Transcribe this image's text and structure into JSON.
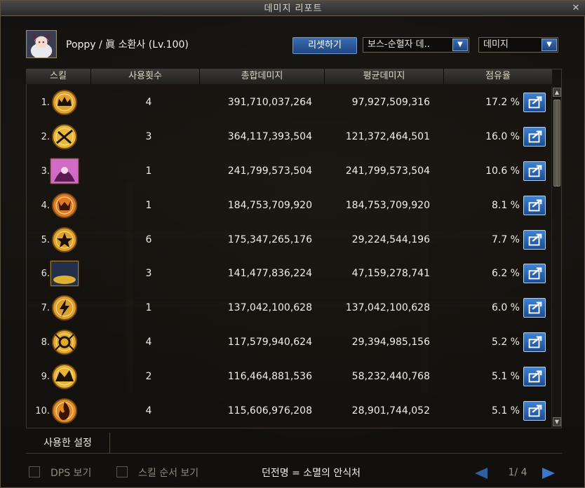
{
  "window": {
    "title": "데미지 리포트",
    "close_glyph": "✕"
  },
  "character": {
    "info": "Poppy / 眞 소환사 (Lv.100)"
  },
  "toolbar": {
    "reset_label": "리셋하기",
    "boss_dropdown": "보스-순혈자 데..",
    "type_dropdown": "데미지"
  },
  "table": {
    "headers": {
      "skill": "스킬",
      "count": "사용횟수",
      "total": "총합데미지",
      "avg": "평균데미지",
      "share": "점유율"
    },
    "rows": [
      {
        "rank": "1.",
        "count": "4",
        "total": "391,710,037,264",
        "avg": "97,927,509,316",
        "share": "17.2 %",
        "icon": "crown-sigil-icon",
        "color": "#e3a22c"
      },
      {
        "rank": "2.",
        "count": "3",
        "total": "364,117,393,504",
        "avg": "121,372,464,501",
        "share": "16.0 %",
        "icon": "slash-sigil-icon",
        "color": "#e7b83a"
      },
      {
        "rank": "3.",
        "count": "1",
        "total": "241,799,573,504",
        "avg": "241,799,573,504",
        "share": "10.6 %",
        "icon": "pink-summon-icon",
        "color": "#d06bc6"
      },
      {
        "rank": "4.",
        "count": "1",
        "total": "184,753,709,920",
        "avg": "184,753,709,920",
        "share": "8.1 %",
        "icon": "demon-sigil-icon",
        "color": "#e07a24"
      },
      {
        "rank": "5.",
        "count": "6",
        "total": "175,347,265,176",
        "avg": "29,224,544,196",
        "share": "7.7 %",
        "icon": "star-sigil-icon",
        "color": "#e0a02a"
      },
      {
        "rank": "6.",
        "count": "3",
        "total": "141,477,836,224",
        "avg": "47,159,278,741",
        "share": "6.2 %",
        "icon": "dark-summon-icon",
        "color": "#c9a132"
      },
      {
        "rank": "7.",
        "count": "1",
        "total": "137,042,100,628",
        "avg": "137,042,100,628",
        "share": "6.0 %",
        "icon": "lightning-sigil-icon",
        "color": "#dea02c"
      },
      {
        "rank": "8.",
        "count": "4",
        "total": "117,579,940,624",
        "avg": "29,394,985,156",
        "share": "5.2 %",
        "icon": "ring-sigil-icon",
        "color": "#e3a82e"
      },
      {
        "rank": "9.",
        "count": "2",
        "total": "116,464,881,536",
        "avg": "58,232,440,768",
        "share": "5.1 %",
        "icon": "beast-sigil-icon",
        "color": "#e8b234"
      },
      {
        "rank": "10.",
        "count": "4",
        "total": "115,606,976,208",
        "avg": "28,901,744,052",
        "share": "5.1 %",
        "icon": "flame-sigil-icon",
        "color": "#e48a26"
      }
    ]
  },
  "tabs": {
    "used_settings": "사용한 설정"
  },
  "footer": {
    "dps_label": "DPS 보기",
    "skill_order_label": "스킬 순서 보기",
    "dungeon": "던전명 = 소멸의 안식처",
    "page": "1/ 4"
  }
}
